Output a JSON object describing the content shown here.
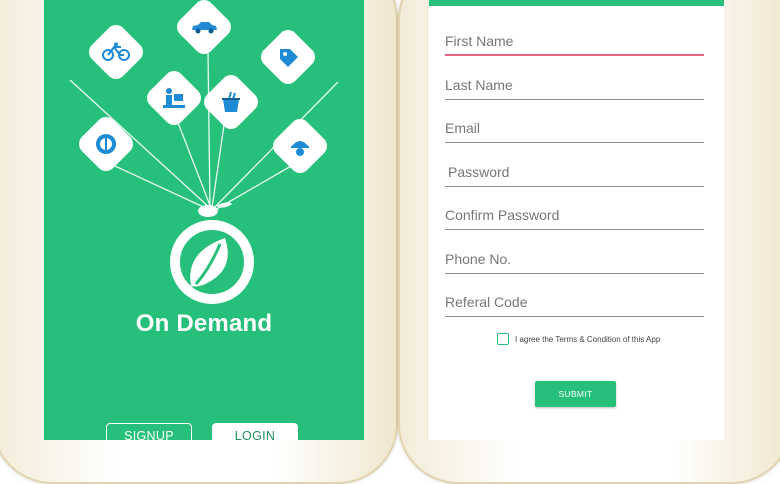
{
  "brand": {
    "name": "On Demand",
    "color": "#27c07a"
  },
  "welcome": {
    "signup_label": "SIGNUP",
    "login_label": "LOGIN",
    "service_icons": [
      "bicycle-icon",
      "car-icon",
      "price-tag-icon",
      "delivery-icon",
      "ice-bucket-icon",
      "food-plate-icon",
      "butler-icon"
    ]
  },
  "form": {
    "fields": [
      {
        "label": "First Name"
      },
      {
        "label": "Last Name"
      },
      {
        "label": "Email"
      },
      {
        "label": "Password"
      },
      {
        "label": "Confirm Password"
      },
      {
        "label": "Phone No."
      },
      {
        "label": "Referal Code"
      }
    ],
    "agree_text": "I agree the Terms & Condition of this App",
    "submit_label": "SUBMIT",
    "active_underline_color": "#e8657f"
  }
}
